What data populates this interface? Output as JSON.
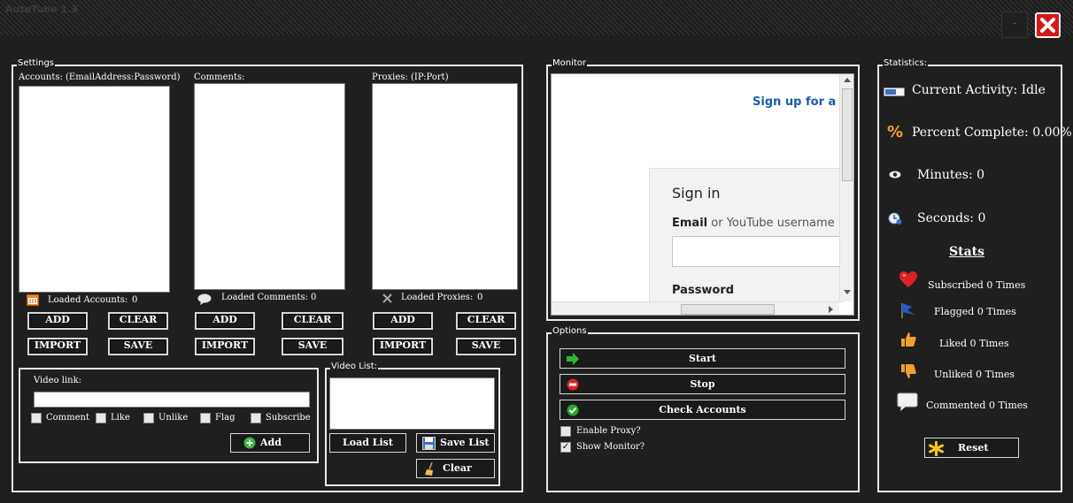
{
  "window": {
    "title": "AutoTube 1.3",
    "minimize_label": "-"
  },
  "settings": {
    "group_label": "Settings",
    "accounts": {
      "header": "Accounts: (EmailAddress:Password)",
      "loaded_label": "Loaded Accounts:",
      "loaded_count": "0"
    },
    "comments": {
      "header": "Comments:",
      "loaded_label": "Loaded Comments:",
      "loaded_count": "0"
    },
    "proxies": {
      "header": "Proxies: (IP:Port)",
      "loaded_label": "Loaded Proxies:",
      "loaded_count": "0"
    },
    "buttons": {
      "add": "ADD",
      "clear": "CLEAR",
      "import": "IMPORT",
      "save": "SAVE"
    },
    "video": {
      "link_label": "Video link:",
      "link_value": "",
      "options": [
        "Comment",
        "Like",
        "Unlike",
        "Flag",
        "Subscribe"
      ],
      "add_label": "Add"
    },
    "video_list": {
      "group_label": "Video List:",
      "load_label": "Load List",
      "save_label": "Save List",
      "clear_label": "Clear"
    }
  },
  "monitor": {
    "group_label": "Monitor",
    "browser": {
      "signup_link": "Sign up for a ne",
      "signin_heading": "Sign in",
      "email_label_bold": "Email",
      "email_label_rest": "or YouTube username",
      "password_label": "Password"
    }
  },
  "options": {
    "group_label": "Options",
    "start_label": "Start",
    "stop_label": "Stop",
    "check_label": "Check Accounts",
    "enable_proxy_label": "Enable Proxy?",
    "enable_proxy_checked": false,
    "show_monitor_label": "Show Monitor?",
    "show_monitor_checked": true
  },
  "statistics": {
    "group_label": "Statistics:",
    "current_activity": "Current Activity: Idle",
    "percent_complete": "Percent Complete: 0.00%",
    "minutes": "Minutes: 0",
    "seconds": "Seconds: 0",
    "stats_heading": "Stats",
    "subscribed": "Subscribed 0 Times",
    "flagged": "Flagged 0 Times",
    "liked": "Liked 0 Times",
    "unliked": "Unliked 0 Times",
    "commented": "Commented 0 Times",
    "reset_label": "Reset"
  },
  "colors": {
    "background": "#1f1f1f",
    "close": "#d11a1a",
    "link": "#1a5da8",
    "start_arrow": "#2db82d",
    "stop": "#d92626",
    "heart": "#e02020",
    "thumb": "#f0a030"
  }
}
